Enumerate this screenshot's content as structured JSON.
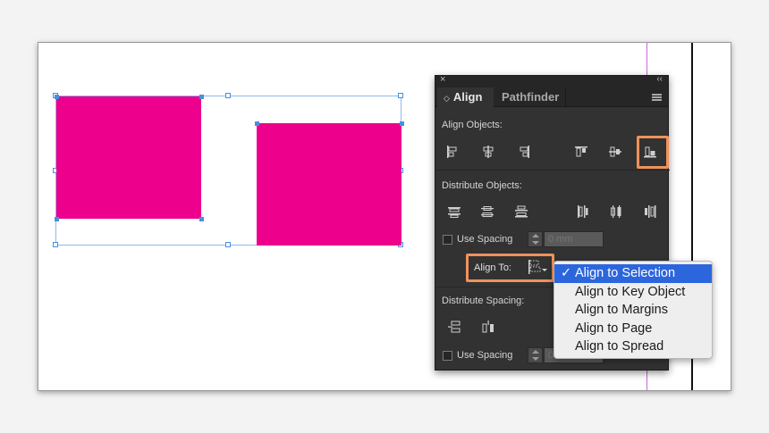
{
  "panel": {
    "close_glyph": "×",
    "collapse_glyph": "‹‹",
    "tabs": [
      {
        "label": "Align",
        "active": true
      },
      {
        "label": "Pathfinder",
        "active": false
      }
    ],
    "align_objects_label": "Align Objects:",
    "distribute_objects_label": "Distribute Objects:",
    "use_spacing_label": "Use Spacing",
    "spacing_placeholder": "0 mm",
    "align_to_label": "Align To:",
    "distribute_spacing_label": "Distribute Spacing:",
    "use_spacing_label_2": "Use Spacing"
  },
  "dropdown": {
    "check_glyph": "✓",
    "items": [
      {
        "label": "Align to Selection",
        "selected": true
      },
      {
        "label": "Align to Key Object",
        "selected": false
      },
      {
        "label": "Align to Margins",
        "selected": false
      },
      {
        "label": "Align to Page",
        "selected": false
      },
      {
        "label": "Align to Spread",
        "selected": false
      }
    ]
  },
  "colors": {
    "object_fill": "#ec008c",
    "highlight": "#f0915a",
    "selected_item": "#2c66dd",
    "panel_bg": "#323232"
  }
}
